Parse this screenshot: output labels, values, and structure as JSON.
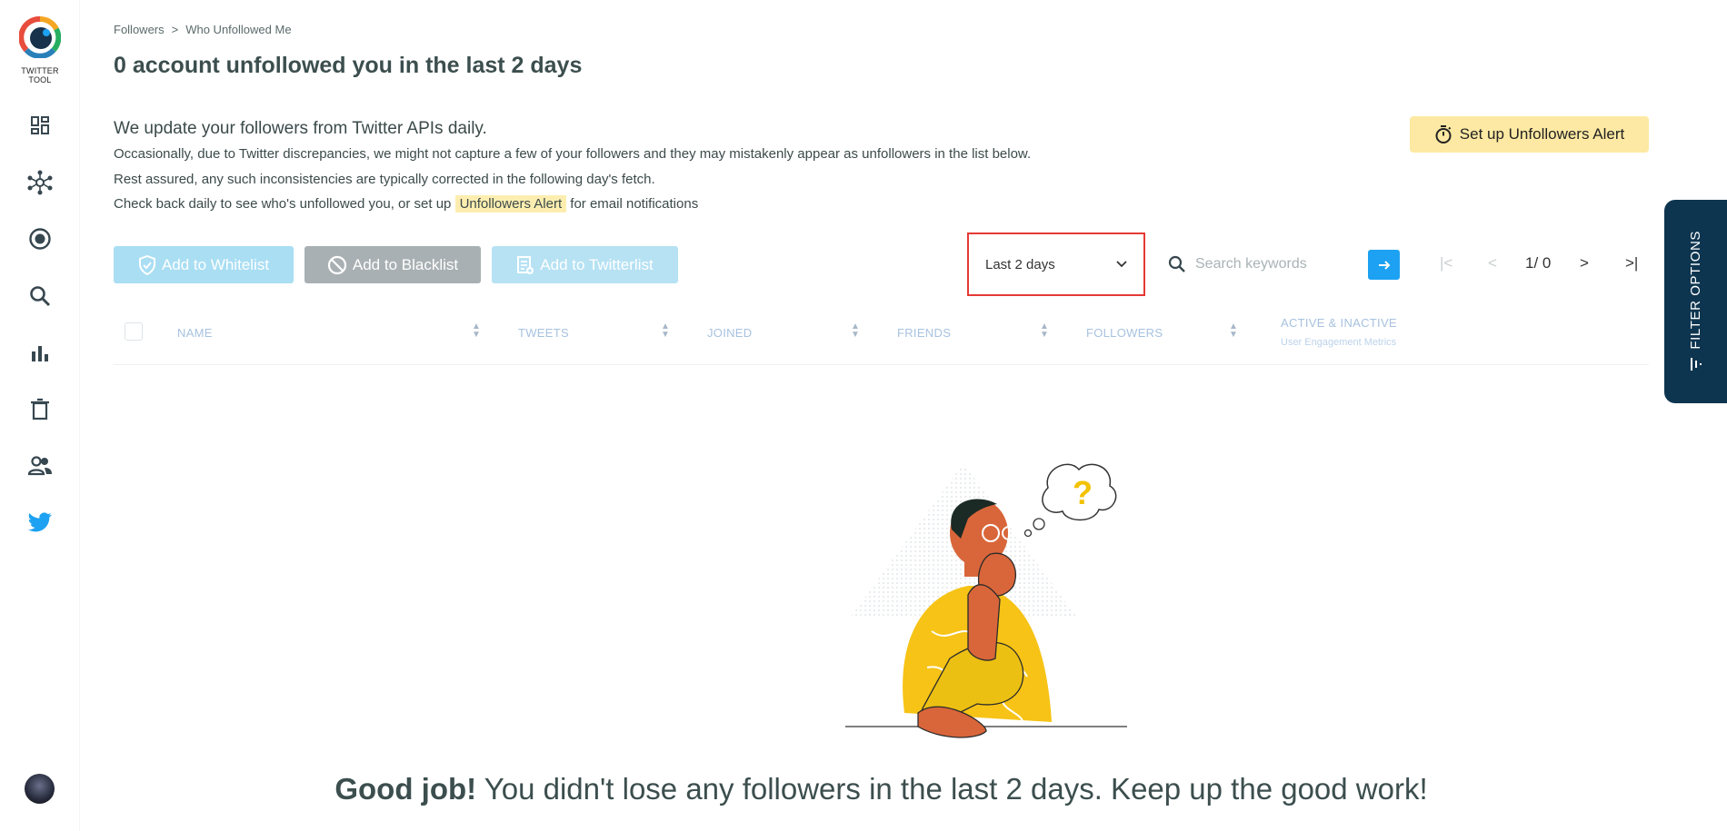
{
  "sidebar": {
    "logo_text": "TWITTER TOOL",
    "items": [
      {
        "icon": "dashboard-icon"
      },
      {
        "icon": "network-icon"
      },
      {
        "icon": "record-icon"
      },
      {
        "icon": "search-icon"
      },
      {
        "icon": "bar-chart-icon"
      },
      {
        "icon": "trash-icon"
      },
      {
        "icon": "users-icon"
      },
      {
        "icon": "twitter-bird-icon"
      }
    ]
  },
  "breadcrumb": {
    "parent": "Followers",
    "separator": ">",
    "current": "Who Unfollowed Me"
  },
  "page_title": "0 account unfollowed you in the last 2 days",
  "info": {
    "heading": "We update your followers from Twitter APIs daily.",
    "line1": "Occasionally, due to Twitter discrepancies, we might not capture a few of your followers and they may mistakenly appear as unfollowers in the list below.",
    "line2": "Rest assured, any such inconsistencies are typically corrected in the following day's fetch.",
    "line3_prefix": "Check back daily to see who's unfollowed you, or set up",
    "line3_highlight": "Unfollowers Alert",
    "line3_suffix": "for email notifications"
  },
  "alert_button": "Set up Unfollowers Alert",
  "actions": {
    "whitelist": "Add to Whitelist",
    "blacklist": "Add to Blacklist",
    "twitterlist": "Add to Twitterlist"
  },
  "filter": {
    "selected": "Last 2 days"
  },
  "search": {
    "placeholder": "Search keywords"
  },
  "pagination": {
    "first": "|<",
    "prev": "<",
    "page_text": "1/ 0",
    "next": ">",
    "last": ">|"
  },
  "table": {
    "columns": [
      "NAME",
      "TWEETS",
      "JOINED",
      "FRIENDS",
      "FOLLOWERS"
    ],
    "activity_col": "ACTIVE & INACTIVE",
    "activity_sub": "User Engagement Metrics"
  },
  "empty_state": {
    "bold": "Good job!",
    "message": " You didn't lose any followers in the last 2 days. Keep up the good work!"
  },
  "filter_tab": "FILTER OPTIONS",
  "colors": {
    "accent": "#1da1f2",
    "highlight": "#fde9a3",
    "filter_tab": "#0e3550",
    "select_border": "#e53935"
  }
}
